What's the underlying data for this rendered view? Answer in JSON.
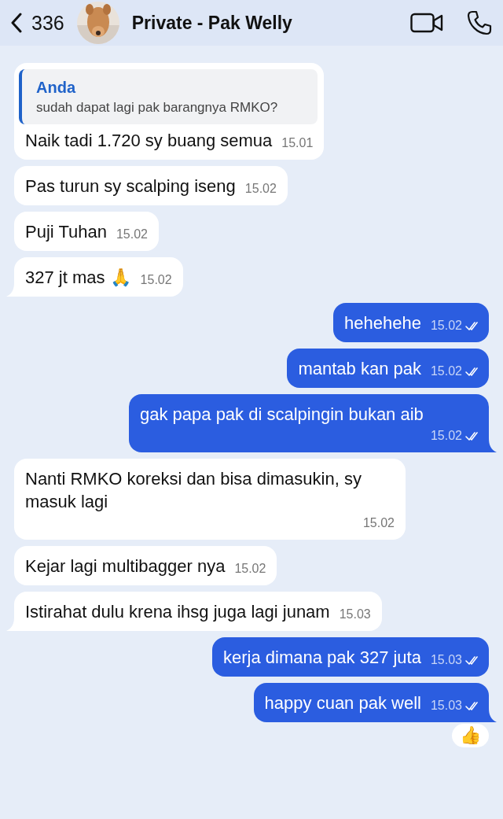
{
  "header": {
    "back_count": "336",
    "title": "Private - Pak Welly"
  },
  "messages": [
    {
      "outgoing": false,
      "reply": {
        "author": "Anda",
        "text": "sudah dapat lagi pak barangnya RMKO?"
      },
      "text": "Naik tadi 1.720 sy buang semua",
      "time": "15.01",
      "tail": false
    },
    {
      "outgoing": false,
      "text": "Pas turun sy scalping iseng",
      "time": "15.02",
      "tail": false
    },
    {
      "outgoing": false,
      "text": "Puji Tuhan",
      "time": "15.02",
      "tail": false
    },
    {
      "outgoing": false,
      "text": "327 jt mas 🙏",
      "time": "15.02",
      "tail": true
    },
    {
      "outgoing": true,
      "text": "hehehehe",
      "time": "15.02",
      "read": true,
      "tail": false
    },
    {
      "outgoing": true,
      "text": "mantab kan pak",
      "time": "15.02",
      "read": true,
      "tail": false
    },
    {
      "outgoing": true,
      "text": "gak papa pak di scalpingin bukan aib",
      "time": "15.02",
      "read": true,
      "tail": true
    },
    {
      "outgoing": false,
      "text": "Nanti RMKO koreksi dan bisa dimasukin, sy masuk lagi",
      "time": "15.02",
      "tail": false
    },
    {
      "outgoing": false,
      "text": "Kejar lagi multibagger nya",
      "time": "15.02",
      "tail": false
    },
    {
      "outgoing": false,
      "text": "Istirahat dulu krena ihsg juga lagi junam",
      "time": "15.03",
      "tail": true
    },
    {
      "outgoing": true,
      "text": "kerja dimana pak 327 juta",
      "time": "15.03",
      "read": true,
      "tail": false
    },
    {
      "outgoing": true,
      "text": "happy cuan pak well",
      "time": "15.03",
      "read": true,
      "tail": true,
      "reaction": "👍"
    }
  ]
}
